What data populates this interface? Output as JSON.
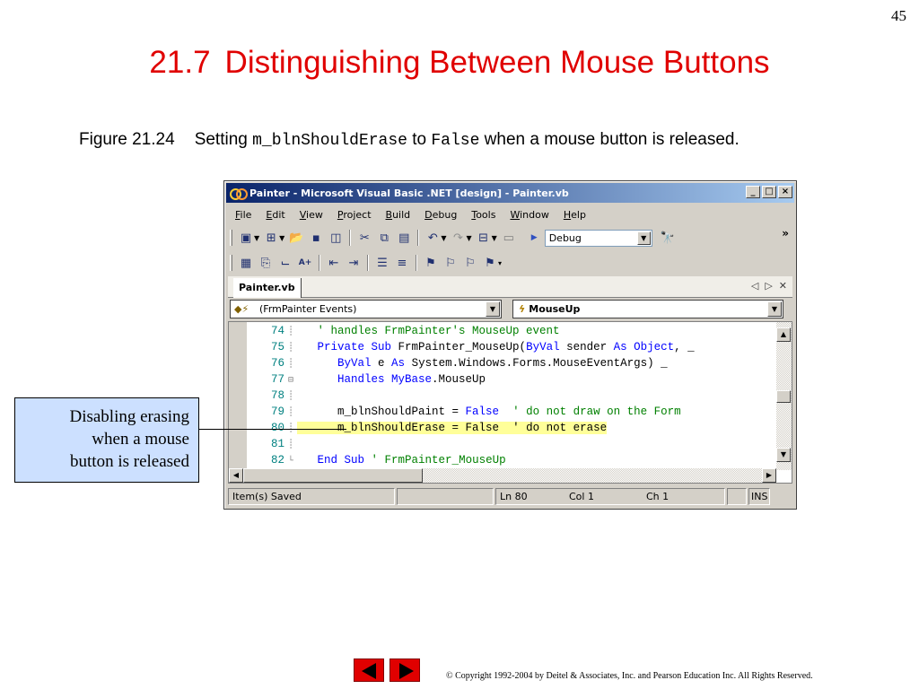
{
  "slide": {
    "page_number": "45",
    "title_number": "21.7",
    "title_text": "Distinguishing Between Mouse Buttons",
    "caption": {
      "figure": "Figure 21.24",
      "part1": "Setting ",
      "code1": "m_blnShouldErase",
      "part2": " to ",
      "code2": "False",
      "part3": " when a mouse button is released."
    },
    "callout_lines": [
      "Disabling erasing",
      "when a mouse",
      "button is released"
    ],
    "copyright": "© Copyright 1992-2004 by Deitel & Associates, Inc. and Pearson Education Inc. All Rights Reserved.",
    "nav_color": "#e00000"
  },
  "window": {
    "title": "Painter - Microsoft Visual Basic .NET [design] - Painter.vb",
    "minimize": "_",
    "maximize": "□",
    "close": "×"
  },
  "menu": [
    "File",
    "Edit",
    "View",
    "Project",
    "Build",
    "Debug",
    "Tools",
    "Window",
    "Help"
  ],
  "toolbar": {
    "config_value": "Debug",
    "overflow": "»"
  },
  "doc_tab": {
    "label": "Painter.vb"
  },
  "dropdowns": {
    "class_value": "(FrmPainter Events)",
    "method_value": "MouseUp"
  },
  "code_lines": [
    {
      "num": "74",
      "segments": [
        {
          "t": "   ",
          "c": ""
        },
        {
          "t": "' handles FrmPainter's MouseUp event",
          "c": "cm"
        }
      ]
    },
    {
      "num": "75",
      "segments": [
        {
          "t": "   ",
          "c": ""
        },
        {
          "t": "Private Sub",
          "c": "kw"
        },
        {
          "t": " FrmPainter_MouseUp(",
          "c": ""
        },
        {
          "t": "ByVal",
          "c": "kw"
        },
        {
          "t": " sender ",
          "c": ""
        },
        {
          "t": "As Object",
          "c": "kw"
        },
        {
          "t": ", _",
          "c": ""
        }
      ]
    },
    {
      "num": "76",
      "segments": [
        {
          "t": "      ",
          "c": ""
        },
        {
          "t": "ByVal",
          "c": "kw"
        },
        {
          "t": " e ",
          "c": ""
        },
        {
          "t": "As",
          "c": "kw"
        },
        {
          "t": " System.Windows.Forms.MouseEventArgs) _",
          "c": ""
        }
      ]
    },
    {
      "num": "77",
      "segments": [
        {
          "t": "      ",
          "c": ""
        },
        {
          "t": "Handles MyBase",
          "c": "kw"
        },
        {
          "t": ".MouseUp",
          "c": ""
        }
      ]
    },
    {
      "num": "78",
      "segments": []
    },
    {
      "num": "79",
      "segments": [
        {
          "t": "      m_blnShouldPaint = ",
          "c": ""
        },
        {
          "t": "False",
          "c": "kw"
        },
        {
          "t": "  ",
          "c": ""
        },
        {
          "t": "' do not draw on the Form",
          "c": "cm"
        }
      ]
    },
    {
      "num": "80",
      "segments": [
        {
          "t": "      m_blnShouldErase = ",
          "c": "hl"
        },
        {
          "t": "False",
          "c": "hl"
        },
        {
          "t": "  ",
          "c": "hl"
        },
        {
          "t": "' do not erase",
          "c": "hl"
        }
      ]
    },
    {
      "num": "81",
      "segments": []
    },
    {
      "num": "82",
      "segments": [
        {
          "t": "   ",
          "c": ""
        },
        {
          "t": "End Sub",
          "c": "kw"
        },
        {
          "t": " ",
          "c": ""
        },
        {
          "t": "' FrmPainter_MouseUp",
          "c": "cm"
        }
      ]
    }
  ],
  "statusbar": {
    "message": "Item(s) Saved",
    "line": "Ln 80",
    "col": "Col 1",
    "ch": "Ch 1",
    "mode": "INS"
  }
}
